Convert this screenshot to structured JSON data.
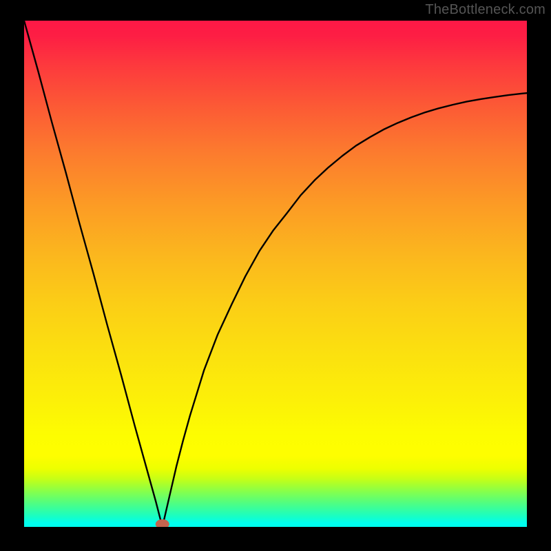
{
  "watermark": "TheBottleneck.com",
  "chart_data": {
    "type": "line",
    "title": "",
    "xlabel": "",
    "ylabel": "",
    "x_range": [
      0,
      1
    ],
    "y_range": [
      0,
      1
    ],
    "note": "x and y are normalized to plot area; y=0 at bottom, y=1 at top. Curve has a sharp minimum near x≈0.275, y≈0; left branch near-straight from (0,1), right branch asymptotes toward y≈0.85 at x=1.",
    "series": [
      {
        "name": "curve",
        "x": [
          0.0,
          0.028,
          0.055,
          0.083,
          0.11,
          0.138,
          0.165,
          0.193,
          0.22,
          0.248,
          0.262,
          0.275,
          0.289,
          0.303,
          0.316,
          0.33,
          0.358,
          0.385,
          0.413,
          0.44,
          0.468,
          0.495,
          0.523,
          0.55,
          0.578,
          0.605,
          0.633,
          0.66,
          0.688,
          0.715,
          0.743,
          0.77,
          0.798,
          0.825,
          0.853,
          0.88,
          0.908,
          0.935,
          0.963,
          0.99,
          1.0
        ],
        "y": [
          1.0,
          0.9,
          0.8,
          0.7,
          0.6,
          0.5,
          0.4,
          0.3,
          0.2,
          0.1,
          0.05,
          0.0,
          0.06,
          0.12,
          0.17,
          0.22,
          0.31,
          0.38,
          0.44,
          0.495,
          0.545,
          0.585,
          0.62,
          0.655,
          0.685,
          0.71,
          0.733,
          0.753,
          0.77,
          0.785,
          0.798,
          0.809,
          0.819,
          0.827,
          0.834,
          0.84,
          0.845,
          0.849,
          0.853,
          0.856,
          0.857
        ]
      }
    ],
    "marker": {
      "x": 0.275,
      "y": 0.0,
      "color": "#c3644f",
      "rx": 10,
      "ry": 7
    },
    "background_gradient": {
      "direction": "vertical",
      "stops": [
        {
          "p": 0.0,
          "c": "#fd1846"
        },
        {
          "p": 0.5,
          "c": "#fbc419"
        },
        {
          "p": 0.82,
          "c": "#fdfd01"
        },
        {
          "p": 0.92,
          "c": "#8aff48"
        },
        {
          "p": 1.0,
          "c": "#00feee"
        }
      ]
    }
  }
}
